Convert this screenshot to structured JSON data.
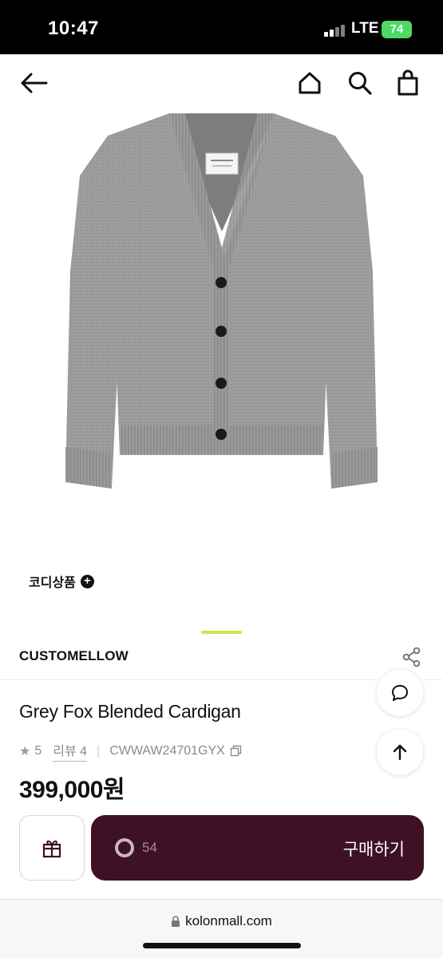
{
  "status_bar": {
    "time": "10:47",
    "network": "LTE",
    "battery": "74"
  },
  "nav": {
    "icons": [
      "back-arrow-icon",
      "home-icon",
      "search-icon",
      "shopping-bag-icon"
    ]
  },
  "product": {
    "image": "grey-v-neck-cardigan",
    "coordination_label": "코디상품",
    "brand": "CUSTOMELLOW",
    "name": "Grey Fox Blended Cardigan",
    "rating": "5",
    "review_label": "리뷰 4",
    "product_code": "CWWAW24701GYX",
    "price": "399,000원"
  },
  "actions": {
    "buy_label": "구매하기",
    "count": "54"
  },
  "browser": {
    "url": "kolonmall.com"
  },
  "colors": {
    "accent_indicator": "#c6e84a",
    "buy_button": "#3e1224"
  }
}
